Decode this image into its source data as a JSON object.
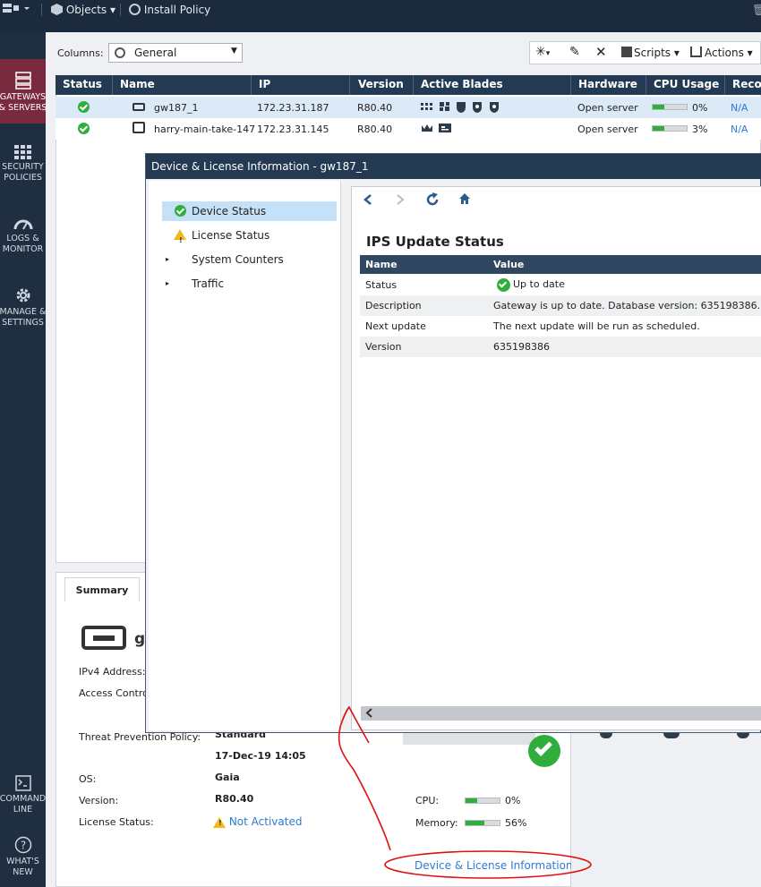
{
  "topbar": {
    "objects_label": "Objects",
    "install_policy_label": "Install Policy"
  },
  "leftnav": {
    "items": [
      {
        "line1": "GATEWAYS",
        "line2": "& SERVERS"
      },
      {
        "line1": "SECURITY",
        "line2": "POLICIES"
      },
      {
        "line1": "LOGS &",
        "line2": "MONITOR"
      },
      {
        "line1": "MANAGE &",
        "line2": "SETTINGS"
      },
      {
        "line1": "COMMAND",
        "line2": "LINE"
      },
      {
        "line1": "WHAT'S",
        "line2": "NEW"
      }
    ]
  },
  "toolbar": {
    "columns_label": "Columns:",
    "columns_value": "General",
    "scripts_label": "Scripts",
    "actions_label": "Actions"
  },
  "table": {
    "headers": [
      "Status",
      "Name",
      "IP",
      "Version",
      "Active Blades",
      "Hardware",
      "CPU Usage",
      "Recor"
    ],
    "rows": [
      {
        "name": "gw187_1",
        "ip": "172.23.31.187",
        "version": "R80.40",
        "hardware": "Open server",
        "cpu": "0%",
        "cpu_fraction": 0.0,
        "recor": "N/A"
      },
      {
        "name": "harry-main-take-147",
        "ip": "172.23.31.145",
        "version": "R80.40",
        "hardware": "Open server",
        "cpu": "3%",
        "cpu_fraction": 0.03,
        "recor": "N/A"
      }
    ]
  },
  "summary": {
    "tab_label": "Summary",
    "name_prefix": "gv",
    "ipv4_label": "IPv4 Address:",
    "access_label": "Access Contro",
    "threat_label": "Threat Prevention Policy:",
    "threat_value": "Standard",
    "threat_date": "17-Dec-19 14:05",
    "os_label": "OS:",
    "os_value": "Gaia",
    "version_label": "Version:",
    "version_value": "R80.40",
    "license_label": "License Status:",
    "license_value": "Not Activated",
    "cpu_label": "CPU:",
    "cpu_value": "0%",
    "cpu_fraction": 0.0,
    "memory_label": "Memory:",
    "memory_value": "56%",
    "memory_fraction": 0.56,
    "device_license_link": "Device & License Information..."
  },
  "dialog": {
    "title": "Device & License Information - gw187_1",
    "tree": [
      {
        "label": "Device Status"
      },
      {
        "label": "License Status"
      },
      {
        "label": "System Counters"
      },
      {
        "label": "Traffic"
      }
    ],
    "section_title": "IPS Update Status",
    "table_headers": [
      "Name",
      "Value"
    ],
    "table_rows": [
      {
        "name": "Status",
        "value": "Up to date"
      },
      {
        "name": "Description",
        "value": "Gateway is up to date. Database version: 635198386."
      },
      {
        "name": "Next update",
        "value": "The next update will be run as scheduled."
      },
      {
        "name": "Version",
        "value": "635198386"
      }
    ]
  },
  "colors": {
    "nav_bg": "#1f2e40",
    "nav_active": "#7a2a3f",
    "header_bg": "#243a52",
    "accent_link": "#2b7bd0",
    "status_green": "#2fae3c",
    "warning_yellow": "#f2b91e",
    "annotation_red": "#e01010"
  }
}
